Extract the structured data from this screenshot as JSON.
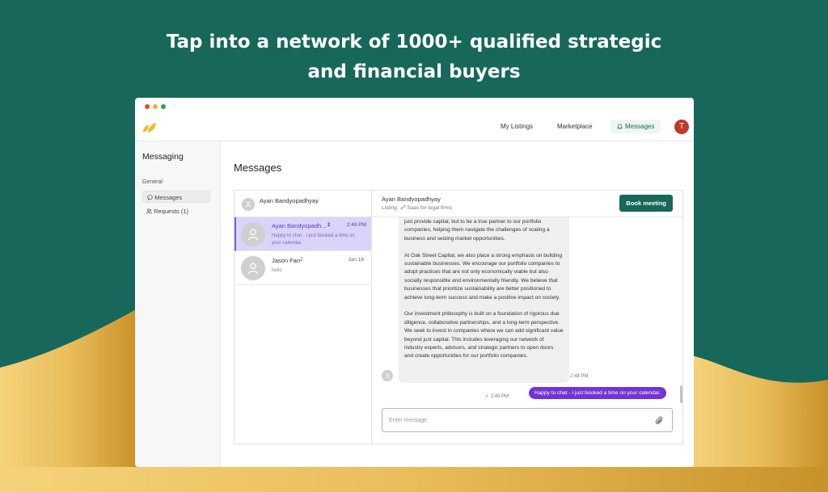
{
  "headline": {
    "line1": "Tap into a network of 1000+ qualified strategic",
    "line2": "and financial buyers"
  },
  "colors": {
    "brand": "#17685a",
    "gold": "#e2b44b",
    "accent_purple": "#7135d6",
    "selected_row": "#dcd3fa"
  },
  "window": {
    "dots": [
      "#e04b3d",
      "#e6b13a",
      "#2aa24a"
    ]
  },
  "nav": {
    "my_listings": "My Listings",
    "marketplace": "Marketplace",
    "messages": "Messages",
    "avatar_initial": "T",
    "messages_icon": "bell-icon"
  },
  "sidebar": {
    "title": "Messaging",
    "section": "General",
    "items": [
      {
        "label": "Messages",
        "icon": "chat-icon"
      },
      {
        "label": "Requests (1)",
        "icon": "users-icon"
      }
    ]
  },
  "main": {
    "title": "Messages"
  },
  "convo_list": {
    "header_name": "Ayan Bandyopadhyay",
    "items": [
      {
        "name": "Ayan Bandyopadh...",
        "badge": "2",
        "time": "2:49 PM",
        "preview": "Happy to chat - I just booked a time on your calendar."
      },
      {
        "name": "Jason Fan",
        "badge": "2",
        "time": "Jan 16",
        "preview": "hello"
      }
    ]
  },
  "chat": {
    "contact_name": "Ayan Bandyopadhyay",
    "listing_label": "Listing:",
    "listing_value": "Saas for legal firms",
    "book_button": "Book meeting",
    "incoming": {
      "p1": "just provide capital, but to be a true partner to our portfolio companies, helping them navigate the challenges of scaling a business and seizing market opportunities.",
      "p2": "At Oak Street Capital, we also place a strong emphasis on building sustainable businesses. We encourage our portfolio companies to adopt practices that are not only economically viable but also socially responsible and environmentally friendly. We believe that businesses that prioritize sustainability are better positioned to achieve long-term success and make a positive impact on society.",
      "p3": "Our investment philosophy is built on a foundation of rigorous due diligence, collaborative partnerships, and a long-term perspective. We seek to invest in companies where we can add significant value beyond just capital. This includes leveraging our network of industry experts, advisors, and strategic partners to open doors and create opportunities for our portfolio companies.",
      "time": "2:48 PM"
    },
    "outgoing": {
      "text": "Happy to chat - I just booked a time on your calendar.",
      "time": "2:49 PM"
    },
    "input_placeholder": "Enter message"
  }
}
